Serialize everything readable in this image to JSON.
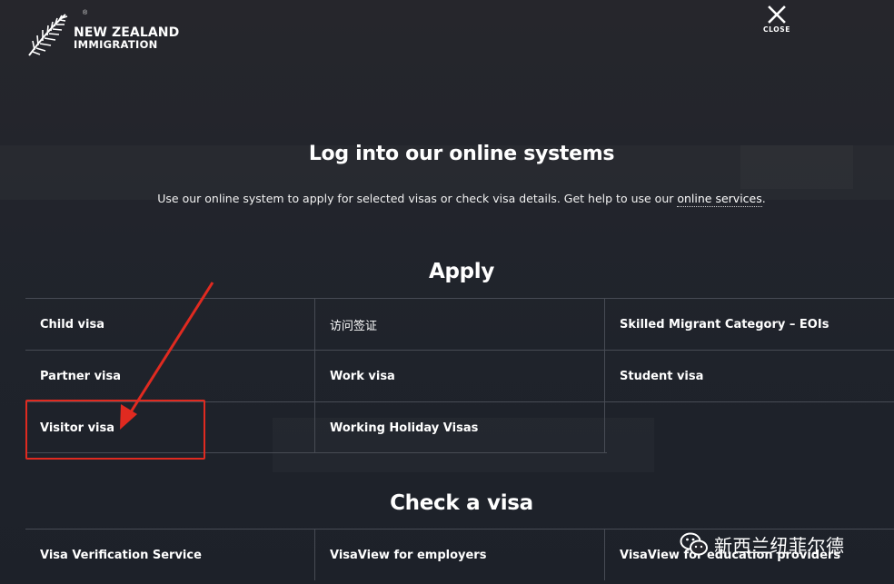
{
  "header": {
    "logo": {
      "line1": "NEW ZEALAND",
      "line2": "IMMIGRATION",
      "registered": "®"
    },
    "close": {
      "label": "CLOSE"
    }
  },
  "main": {
    "title": "Log into our online systems",
    "intro": {
      "text": "Use our online system to apply for selected visas or check visa details. Get help to use our ",
      "link": "online services",
      "end": "."
    },
    "apply": {
      "heading": "Apply",
      "rows": [
        [
          "Child visa",
          "访问签证",
          "Skilled Migrant Category – EOIs"
        ],
        [
          "Partner visa",
          "Work visa",
          "Student visa"
        ],
        [
          "Visitor visa",
          "Working Holiday Visas",
          ""
        ]
      ]
    },
    "check": {
      "heading": "Check a visa",
      "rows": [
        [
          "Visa Verification Service",
          "VisaView for employers",
          "VisaView for education providers"
        ]
      ]
    }
  },
  "annotation": {
    "color": "#e02a20"
  },
  "watermark": {
    "text": "新西兰纽菲尔德",
    "icon": "wechat-icon"
  },
  "colors": {
    "background": "#25252b",
    "divider": "#474b54",
    "text": "#ffffff"
  }
}
